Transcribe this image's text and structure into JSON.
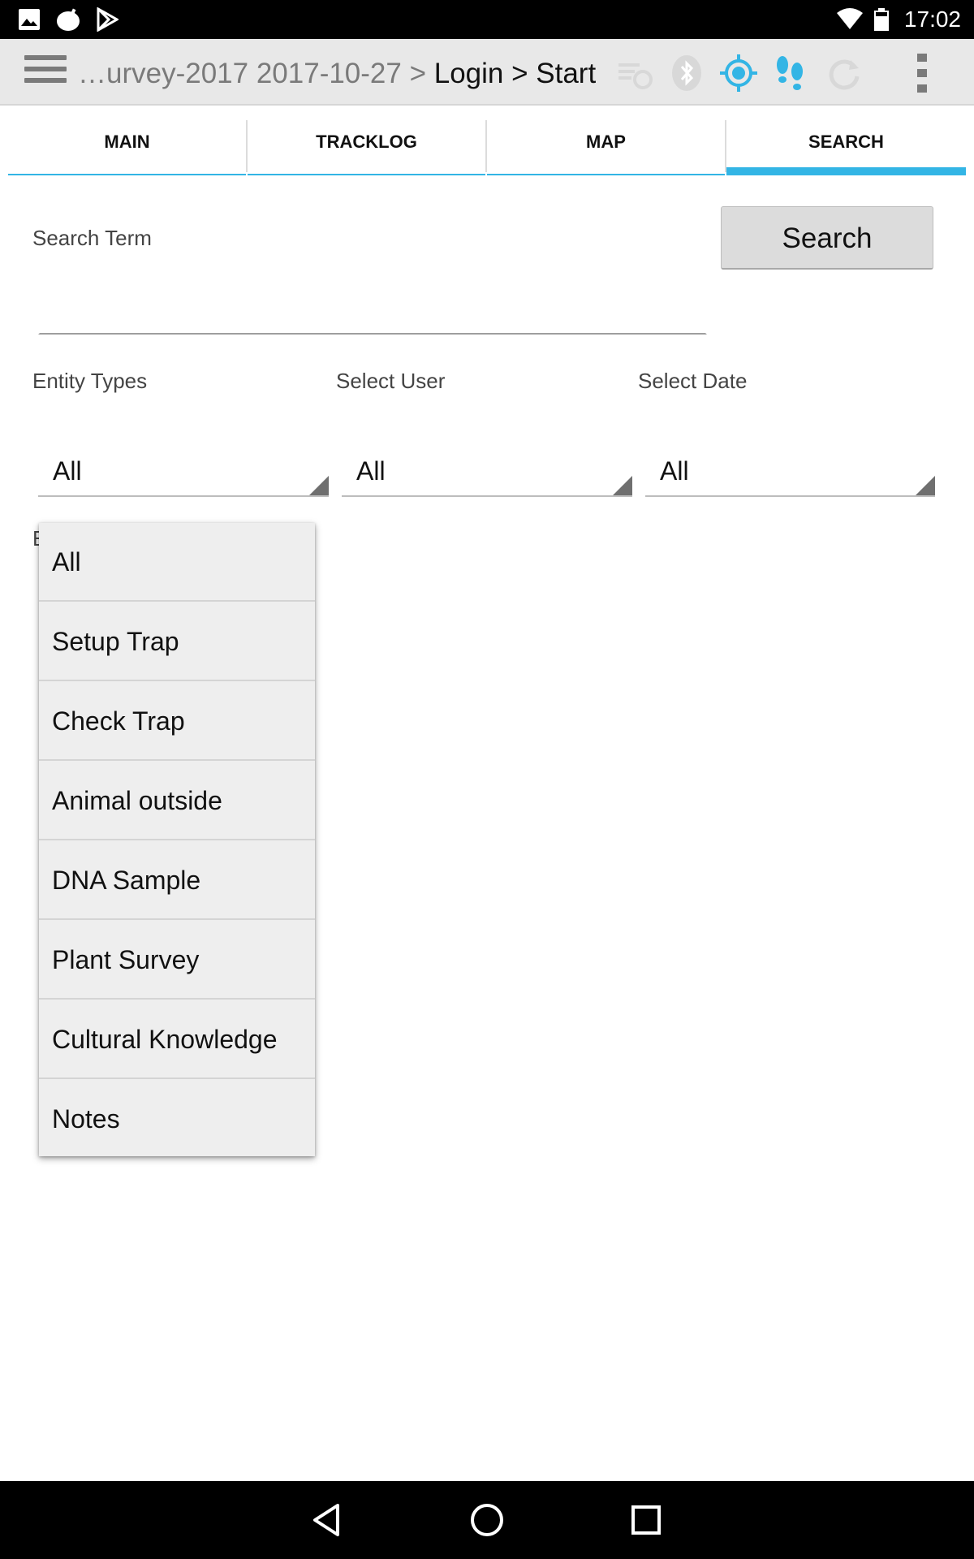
{
  "status_bar": {
    "time": "17:02",
    "left_icons": [
      "image-icon",
      "android-icon",
      "play-store-icon"
    ],
    "right_icons": [
      "wifi-icon",
      "battery-icon"
    ]
  },
  "action_bar": {
    "breadcrumb_dim": "…urvey-2017 2017-10-27 > ",
    "breadcrumb_current": "Login > Start",
    "icons": [
      "sync-list-icon",
      "bluetooth-icon",
      "gps-icon",
      "footsteps-icon",
      "refresh-icon",
      "overflow-menu-icon"
    ],
    "accent_color": "#33b5e5"
  },
  "tabs": [
    {
      "label": "MAIN",
      "active": false
    },
    {
      "label": "TRACKLOG",
      "active": false
    },
    {
      "label": "MAP",
      "active": false
    },
    {
      "label": "SEARCH",
      "active": true
    }
  ],
  "form": {
    "search_term_label": "Search Term",
    "search_term_value": "",
    "search_button": "Search",
    "entity_types_label": "Entity Types",
    "select_user_label": "Select User",
    "select_date_label": "Select Date",
    "entity_types_value": "All",
    "select_user_value": "All",
    "select_date_value": "All",
    "behind_dropdown_char": "E"
  },
  "dropdown": {
    "items": [
      "All",
      "Setup Trap",
      "Check Trap",
      "Animal outside",
      "DNA Sample",
      "Plant Survey",
      "Cultural Knowledge",
      "Notes"
    ]
  },
  "nav_bar": {
    "icons": [
      "back-icon",
      "home-icon",
      "recents-icon"
    ]
  }
}
